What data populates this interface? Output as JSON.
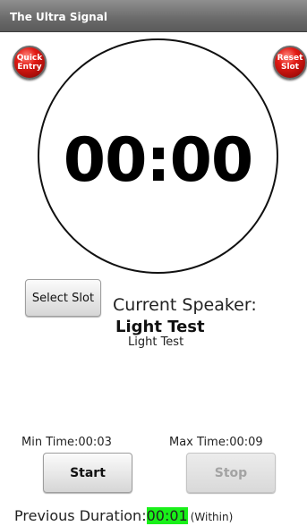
{
  "app": {
    "title": "The Ultra Signal"
  },
  "buttons": {
    "quick_entry": "Quick\nEntry",
    "reset_slot": "Reset\nSlot",
    "select_slot": "Select Slot",
    "start": "Start",
    "stop": "Stop"
  },
  "timer": {
    "display": "00:00"
  },
  "speaker": {
    "label": "Current Speaker:",
    "name": "Light Test",
    "detail": "Light Test"
  },
  "limits": {
    "min": "Min Time:00:03",
    "max": "Max Time:00:09"
  },
  "previous": {
    "label": "Previous Duration:",
    "value": "00:01",
    "status": "(Within)"
  },
  "colors": {
    "accent_red": "#e21a14",
    "within_highlight": "#19f019"
  }
}
